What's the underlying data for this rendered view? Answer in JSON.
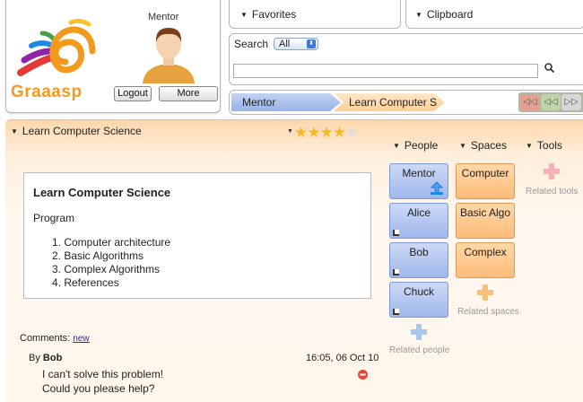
{
  "profile": {
    "name": "Mentor",
    "logo_text": "Graaasp",
    "logout_label": "Logout",
    "more_label": "More"
  },
  "tabs": {
    "favorites_label": "Favorites",
    "clipboard_label": "Clipboard"
  },
  "search": {
    "label": "Search",
    "scope_value": "All",
    "query": ""
  },
  "breadcrumb": {
    "items": [
      "Mentor",
      "Learn Computer S"
    ]
  },
  "space": {
    "title": "Learn Computer Science",
    "rating": 4,
    "rating_max": 5,
    "description_title": "Learn Computer Science",
    "description_subtitle": "Program",
    "program": [
      "1. Computer architecture",
      "2. Basic Algorithms",
      "3. Complex Algorithms",
      "4. References"
    ]
  },
  "columns": {
    "people_label": "People",
    "spaces_label": "Spaces",
    "tools_label": "Tools"
  },
  "people": [
    "Mentor",
    "Alice",
    "Bob",
    "Chuck"
  ],
  "spaces": [
    "Computer",
    "Basic Algo",
    "Complex"
  ],
  "related": {
    "people": "Related people",
    "spaces": "Related spaces",
    "tools": "Related tools"
  },
  "comments": {
    "label": "Comments:",
    "new_link": "new",
    "items": [
      {
        "by_prefix": "By",
        "author": "Bob",
        "date": "16:05, 06 Oct 10",
        "line1": "I can't solve this problem!",
        "line2": "Could you please help?"
      }
    ]
  },
  "colors": {
    "accent_orange": "#f39a1e",
    "person_card": "#9fb7ec",
    "space_card": "#fdbb7a"
  }
}
